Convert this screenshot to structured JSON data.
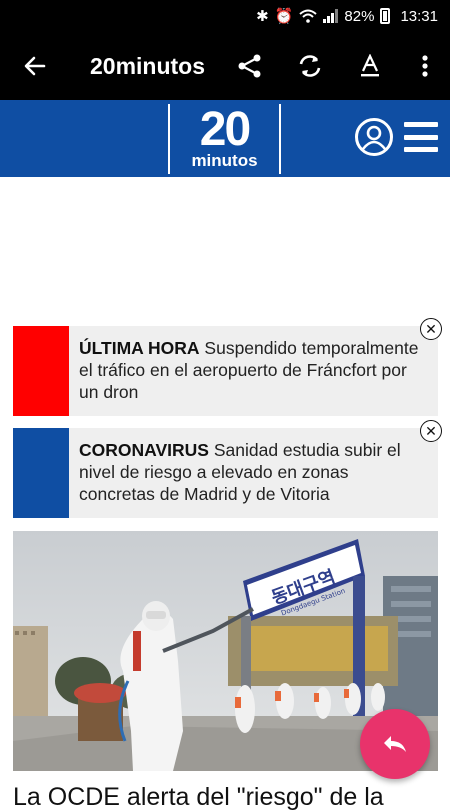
{
  "status_bar": {
    "battery": "82%",
    "time": "13:31"
  },
  "app_bar": {
    "title": "20minutos"
  },
  "site_header": {
    "logo_number": "20",
    "logo_word": "minutos",
    "brand_color": "#0f4ea3"
  },
  "news": [
    {
      "label": "ÚLTIMA HORA",
      "text": "Suspendido temporalmente el tráfico en el aeropuerto de Fráncfort por un dron",
      "color": "#ff0000"
    },
    {
      "label": "CORONAVIRUS",
      "text": "Sanidad estudia subir el nivel de riesgo a elevado en zonas concretas de Madrid y de Vitoria",
      "color": "#0f4ea3"
    }
  ],
  "photo": {
    "station_sign": "동대구역",
    "station_sub": "Dongdaegu Station"
  },
  "headline": "La OCDE alerta del \"riesgo\" de la"
}
